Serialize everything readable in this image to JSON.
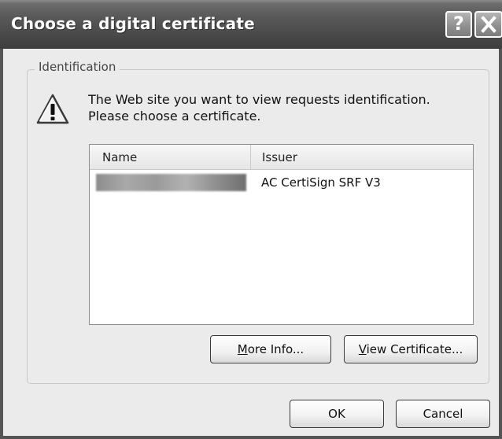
{
  "window": {
    "title": "Choose a digital certificate",
    "help_button": "?",
    "close_button": "X"
  },
  "identification": {
    "group_label": "Identification",
    "message": "The Web site you want to view requests identification. Please choose a certificate.",
    "icon": "warning-icon"
  },
  "certificate_list": {
    "columns": [
      "Name",
      "Issuer"
    ],
    "rows": [
      {
        "name": "",
        "issuer": "AC CertiSign SRF V3"
      }
    ]
  },
  "buttons": {
    "more_info": {
      "mnemonic": "M",
      "rest": "ore Info..."
    },
    "view_certificate": {
      "mnemonic": "V",
      "rest": "iew Certificate..."
    },
    "ok": "OK",
    "cancel": "Cancel"
  }
}
